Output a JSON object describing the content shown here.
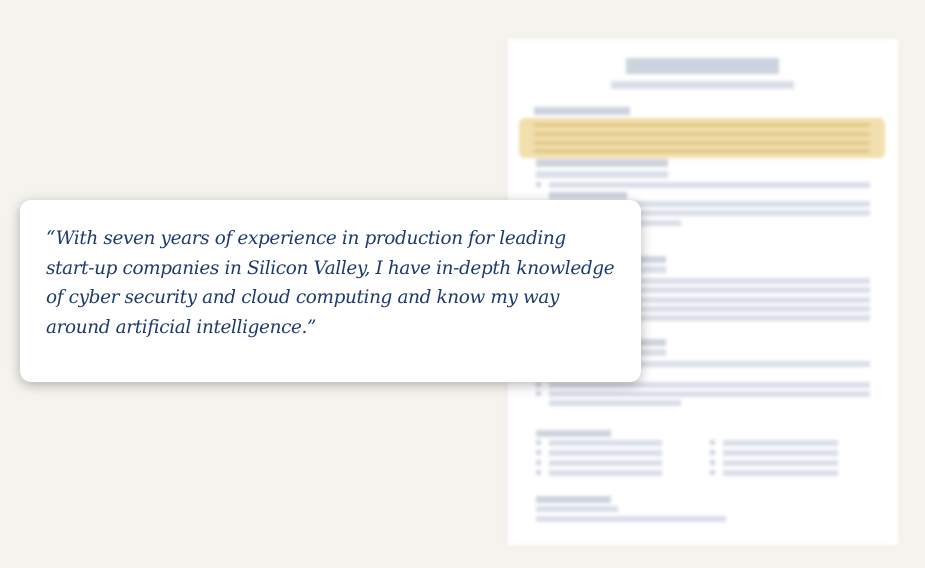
{
  "quote": {
    "text": "“With seven years of experience in production for leading start-up companies in Silicon Valley, I have in-depth knowledge of cyber security and cloud computing and know my way around artificial intelligence.”"
  },
  "resume": {
    "highlight_color": "#f2dfae",
    "placeholder_color": "#d9dee8"
  },
  "colors": {
    "background": "#f5f3ee",
    "quote_text": "#1d3a6e"
  }
}
